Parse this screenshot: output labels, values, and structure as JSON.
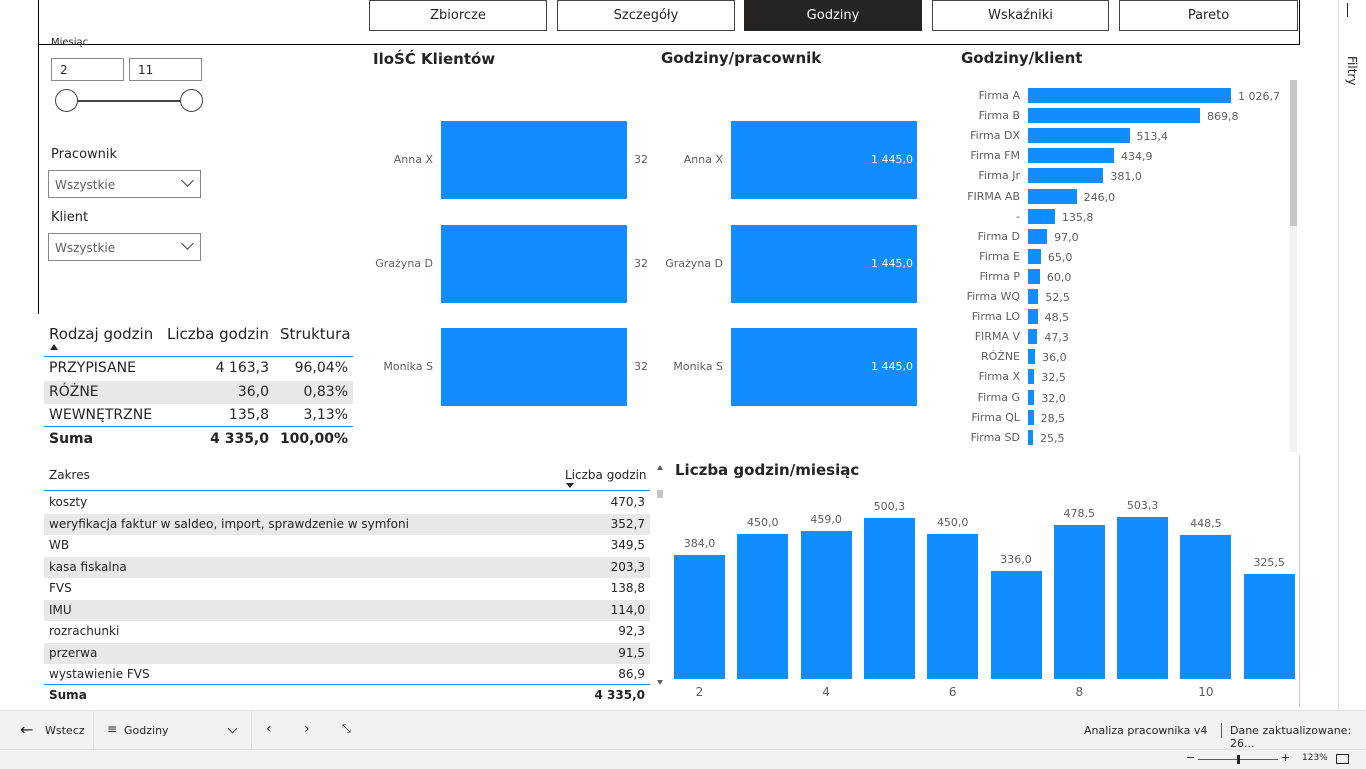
{
  "tabs": [
    {
      "label": "Zbiorcze",
      "active": false
    },
    {
      "label": "Szczegóły",
      "active": false
    },
    {
      "label": "Godziny",
      "active": true
    },
    {
      "label": "Wskaźniki",
      "active": false
    },
    {
      "label": "Pareto",
      "active": false
    }
  ],
  "filters_pane": {
    "label": "Filtry"
  },
  "month_slicer": {
    "label": "Miesiąc",
    "from": "2",
    "to": "11"
  },
  "employee_slicer": {
    "label": "Pracownik",
    "value": "Wszystkie"
  },
  "client_slicer": {
    "label": "Klient",
    "value": "Wszystkie"
  },
  "summary_table": {
    "headers": [
      "Rodzaj godzin",
      "Liczba godzin",
      "Struktura"
    ],
    "rows": [
      [
        "PRZYPISANE",
        "4 163,3",
        "96,04%"
      ],
      [
        "RÓŻNE",
        "36,0",
        "0,83%"
      ],
      [
        "WEWNĘTRZNE",
        "135,8",
        "3,13%"
      ]
    ],
    "total": [
      "Suma",
      "4 335,0",
      "100,00%"
    ]
  },
  "detail_table": {
    "headers": [
      "Zakres",
      "Liczba godzin"
    ],
    "rows": [
      [
        "koszty",
        "470,3"
      ],
      [
        "weryfikacja faktur w saldeo, import, sprawdzenie w symfoni",
        "352,7"
      ],
      [
        "WB",
        "349,5"
      ],
      [
        "kasa fiskalna",
        "203,3"
      ],
      [
        "FVS",
        "138,8"
      ],
      [
        "IMU",
        "114,0"
      ],
      [
        "rozrachunki",
        "92,3"
      ],
      [
        "przerwa",
        "91,5"
      ],
      [
        "wystawienie FVS",
        "86,9"
      ]
    ],
    "total": [
      "Suma",
      "4 335,0"
    ]
  },
  "chart_data": [
    {
      "type": "bar",
      "orientation": "horizontal",
      "title": "IloŚĆ Klientów",
      "categories": [
        "Anna X",
        "Grażyna D",
        "Monika S"
      ],
      "values": [
        32,
        32,
        32
      ],
      "value_labels": [
        "32",
        "32",
        "32"
      ]
    },
    {
      "type": "bar",
      "orientation": "horizontal",
      "title": "Godziny/pracownik",
      "categories": [
        "Anna X",
        "Grażyna D",
        "Monika S"
      ],
      "values": [
        1445.0,
        1445.0,
        1445.0
      ],
      "value_labels": [
        "1 445,0",
        "1 445,0",
        "1 445,0"
      ]
    },
    {
      "type": "bar",
      "orientation": "horizontal",
      "title": "Godziny/klient",
      "categories": [
        "Firma A",
        "Firma B",
        "Firma DX",
        "Firma FM",
        "Firma Jr",
        "FIRMA AB",
        "-",
        "Firma D",
        "Firma E",
        "Firma P",
        "Firma WQ",
        "Firma LO",
        "FIRMA V",
        "RÓŻNE",
        "Firma X",
        "Firma G",
        "Firma QL",
        "Firma SD"
      ],
      "values": [
        1026.7,
        869.8,
        513.4,
        434.9,
        381.0,
        246.0,
        135.8,
        97.0,
        65.0,
        60.0,
        52.5,
        48.5,
        47.3,
        36.0,
        32.5,
        32.0,
        28.5,
        25.5
      ],
      "value_labels": [
        "1 026,7",
        "869,8",
        "513,4",
        "434,9",
        "381,0",
        "246,0",
        "135,8",
        "97,0",
        "65,0",
        "60,0",
        "52,5",
        "48,5",
        "47,3",
        "36,0",
        "32,5",
        "32,0",
        "28,5",
        "25,5"
      ]
    },
    {
      "type": "bar",
      "orientation": "vertical",
      "title": "Liczba godzin/miesiąc",
      "categories": [
        "2",
        "3",
        "4",
        "5",
        "6",
        "7",
        "8",
        "9",
        "10",
        "11"
      ],
      "x_tick_labels": [
        "2",
        "4",
        "6",
        "8",
        "10"
      ],
      "values": [
        384.0,
        450.0,
        459.0,
        500.3,
        450.0,
        336.0,
        478.5,
        503.3,
        448.5,
        325.5
      ],
      "value_labels": [
        "384,0",
        "450,0",
        "459,0",
        "500,3",
        "450,0",
        "336,0",
        "478,5",
        "503,3",
        "448,5",
        "325,5"
      ]
    }
  ],
  "statusbar": {
    "back_label": "Wstecz",
    "page_label": "Godziny",
    "report_name": "Analiza pracownika v4",
    "updated_label": "Dane zaktualizowane: 26...",
    "zoom": "123%"
  },
  "colors": {
    "bar": "#118DFF",
    "tab_active": "#252423"
  }
}
